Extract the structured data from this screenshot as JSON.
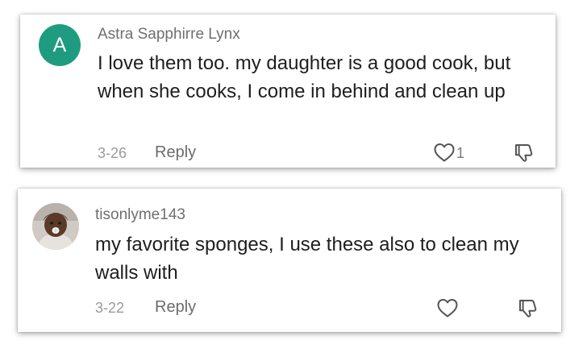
{
  "comments": [
    {
      "avatar_letter": "A",
      "avatar_color": "#1f9c7f",
      "username": "Astra Sapphirre Lynx",
      "text": "I love them too. my daughter is a good cook, but when she cooks, I come in behind and clean up",
      "date": "3-26",
      "reply_label": "Reply",
      "like_count": "1",
      "like_icon": "heart-outline-icon",
      "dislike_icon": "thumbs-down-icon"
    },
    {
      "avatar_image": "child-profile-photo",
      "username": "tisonlyme143",
      "text": "my favorite sponges, I use these also to clean my walls with",
      "date": "3-22",
      "reply_label": "Reply",
      "like_icon": "heart-outline-icon",
      "dislike_icon": "thumbs-down-icon"
    }
  ]
}
